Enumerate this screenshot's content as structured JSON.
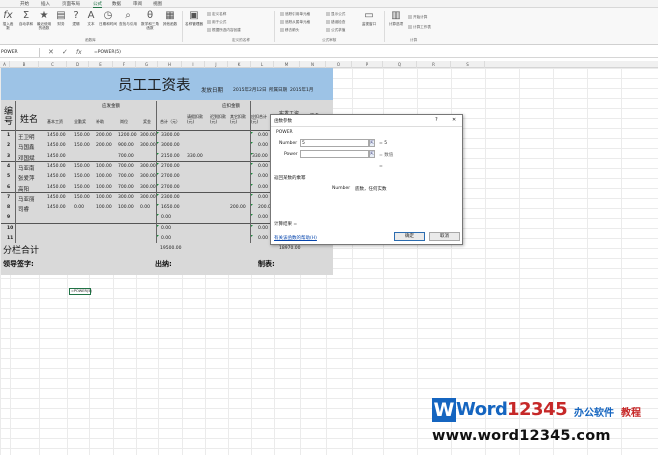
{
  "ribbon": {
    "tabs": [
      "开始",
      "插入",
      "页面布局",
      "公式",
      "数据",
      "审阅",
      "视图"
    ],
    "active_tab": "公式",
    "buttons": [
      "插入函数",
      "自动求和",
      "最近使用的函数",
      "财务",
      "逻辑",
      "文本",
      "日期和时间",
      "查找与引用",
      "数学和三角函数",
      "其他函数",
      "名称管理器"
    ],
    "small_items": [
      "定义名称",
      "用于公式",
      "根据所选内容创建",
      "追踪引用单元格",
      "追踪从属单元格",
      "移去箭头",
      "显示公式",
      "错误检查",
      "公式求值",
      "监视窗口",
      "计算选项",
      "开始计算",
      "计算工作表"
    ],
    "groups": [
      "函数库",
      "定义的名称",
      "公式审核",
      "计算"
    ]
  },
  "formula_bar": {
    "name_box": "POWER",
    "cancel": "✕",
    "enter": "✓",
    "fx": "fx",
    "formula": "=POWER(5)"
  },
  "columns": [
    "A",
    "B",
    "C",
    "D",
    "E",
    "F",
    "G",
    "H",
    "I",
    "J",
    "K",
    "L",
    "M",
    "N",
    "O",
    "P",
    "Q",
    "R",
    "S"
  ],
  "sheet": {
    "title": "员工工资表",
    "issue_date_label": "发放日期",
    "issue_date": "2015年2月12日",
    "belong_label": "所属日期",
    "belong_date": "2015年1月",
    "col_no": "编号",
    "col_name": "姓名",
    "group_payable": "应发金额",
    "group_deduct": "应扣金额",
    "col_actual": "实发工资",
    "col_sign": "签名",
    "sub_headers": [
      "基本工资",
      "全勤奖",
      "补助",
      "岗位",
      "奖金",
      "合计（元）",
      "请假扣款(元)",
      "迟到扣款(元)",
      "其它扣款(元)",
      "应扣合计(元)"
    ],
    "rows": [
      {
        "no": "1",
        "name": "王卫明",
        "c": [
          "1450.00",
          "150.00",
          "200.00",
          "1200.00",
          "300.00",
          "3300.00",
          "",
          "",
          "",
          ""
        ],
        "total": "0.00"
      },
      {
        "no": "2",
        "name": "马国鑫",
        "c": [
          "1450.00",
          "150.00",
          "200.00",
          "900.00",
          "300.00",
          "3000.00",
          "",
          "",
          "",
          ""
        ],
        "total": "0.00"
      },
      {
        "no": "3",
        "name": "邓国斌",
        "c": [
          "1450.00",
          "",
          "",
          "700.00",
          "",
          "2150.00",
          "330.00",
          "",
          "",
          "330.00"
        ],
        "total": ""
      },
      {
        "no": "4",
        "name": "马亚南",
        "c": [
          "1450.00",
          "150.00",
          "100.00",
          "700.00",
          "300.00",
          "2700.00",
          "",
          "",
          "",
          ""
        ],
        "total": "0.00"
      },
      {
        "no": "5",
        "name": "张爱萍",
        "c": [
          "1450.00",
          "150.00",
          "100.00",
          "700.00",
          "300.00",
          "2700.00",
          "",
          "",
          "",
          ""
        ],
        "total": "0.00"
      },
      {
        "no": "6",
        "name": "高阳",
        "c": [
          "1450.00",
          "150.00",
          "100.00",
          "700.00",
          "300.00",
          "2700.00",
          "",
          "",
          "",
          ""
        ],
        "total": "0.00"
      },
      {
        "no": "7",
        "name": "马亚丽",
        "c": [
          "1450.00",
          "150.00",
          "100.00",
          "300.00",
          "300.00",
          "2300.00",
          "",
          "",
          "",
          ""
        ],
        "total": "0.00"
      },
      {
        "no": "8",
        "name": "司睿",
        "c": [
          "1450.00",
          "0.00",
          "100.00",
          "100.00",
          "0.00",
          "1650.00",
          "",
          "",
          "200.00",
          ""
        ],
        "total": "200.00"
      },
      {
        "no": "9",
        "name": "",
        "c": [
          "",
          "",
          "",
          "",
          "",
          "0.00",
          "",
          "",
          "",
          ""
        ],
        "total": "0.00"
      },
      {
        "no": "10",
        "name": "",
        "c": [
          "",
          "",
          "",
          "",
          "",
          "0.00",
          "",
          "",
          "",
          ""
        ],
        "total": "0.00"
      },
      {
        "no": "11",
        "name": "",
        "c": [
          "",
          "",
          "",
          "",
          "",
          "0.00",
          "",
          "",
          "",
          ""
        ],
        "total": "0.00"
      }
    ],
    "subtotal_label": "分栏合计",
    "subtotal_value": "19500.00",
    "subtotal_actual": "18970.00",
    "leader_sign": "领导签字:",
    "cashier": "出纳:",
    "maker": "制表:",
    "edit_cell": "=POWER(5)"
  },
  "dialog": {
    "title": "函数参数",
    "help": "?",
    "close": "✕",
    "func_name": "POWER",
    "arg1_label": "Number",
    "arg1_value": "5",
    "arg1_result": "= 5",
    "arg2_label": "Power",
    "arg2_value": "",
    "arg2_result": "= 数值",
    "result_eq": "=",
    "desc": "返回某数的乘幂",
    "arg_desc_label": "Number",
    "arg_desc": "底数，任何实数",
    "calc_result": "计算结果 =",
    "help_link": "有关该函数的帮助(H)",
    "ok": "确定",
    "cancel": "取消"
  },
  "watermark": {
    "word": "Word",
    "digits": "12345",
    "cn": "办公软件",
    "cn2": "教程",
    "url": "www.word12345.com"
  }
}
